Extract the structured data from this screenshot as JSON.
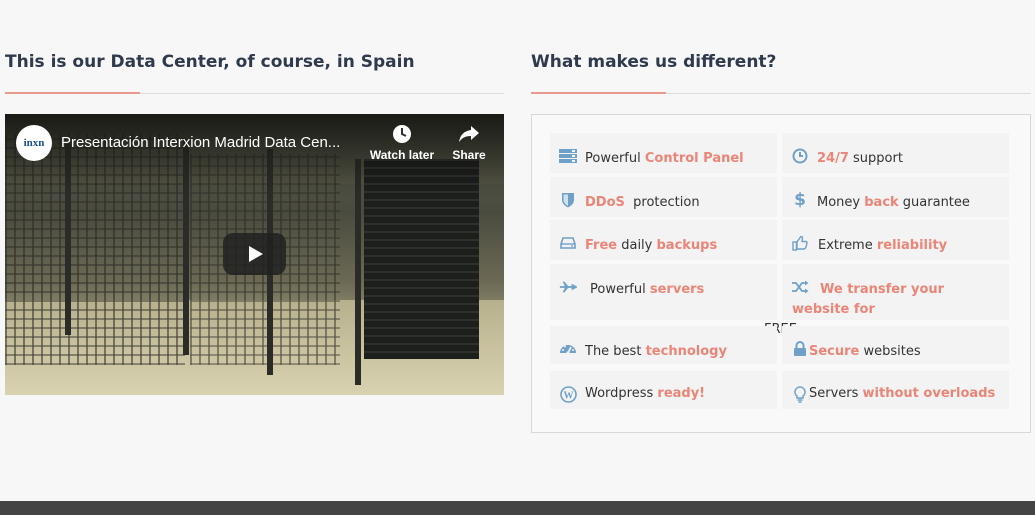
{
  "left": {
    "title": "This is our Data Center, of course, in Spain",
    "video": {
      "title": "Presentación Interxion Madrid Data Cen...",
      "channel_logo": "inxn",
      "watch_later": "Watch later",
      "share": "Share"
    }
  },
  "right": {
    "title": "What makes us different?",
    "features": [
      {
        "icon": "server-icon",
        "parts": [
          "Powerful ",
          "Control Panel"
        ]
      },
      {
        "icon": "clock-icon",
        "parts": [
          "24/7",
          " support"
        ]
      },
      {
        "icon": "shield-icon",
        "parts": [
          "DDoS",
          "  protection"
        ]
      },
      {
        "icon": "dollar-icon",
        "parts": [
          "Money ",
          "back",
          " guarantee"
        ]
      },
      {
        "icon": "hdd-icon",
        "parts": [
          "Free",
          " daily ",
          "backups"
        ]
      },
      {
        "icon": "thumbs-up-icon",
        "parts": [
          "Extreme ",
          "reliability"
        ]
      },
      {
        "icon": "plane-icon",
        "parts": [
          "Powerful ",
          "servers"
        ]
      },
      {
        "icon": "shuffle-icon",
        "parts": [
          "We transfer your website for",
          "FREE"
        ]
      },
      {
        "icon": "dashboard-icon",
        "parts": [
          "The best ",
          "technology"
        ]
      },
      {
        "icon": "lock-icon",
        "parts": [
          "Secure",
          " websites"
        ]
      },
      {
        "icon": "wordpress-icon",
        "parts": [
          "Wordpress ",
          "ready!"
        ]
      },
      {
        "icon": "lightbulb-icon",
        "parts": [
          "Servers ",
          "without overloads"
        ]
      }
    ]
  },
  "colors": {
    "accent": "#ea8577",
    "icon": "#6ea0c8",
    "heading": "#2f3b4c",
    "footer": "#444444"
  }
}
